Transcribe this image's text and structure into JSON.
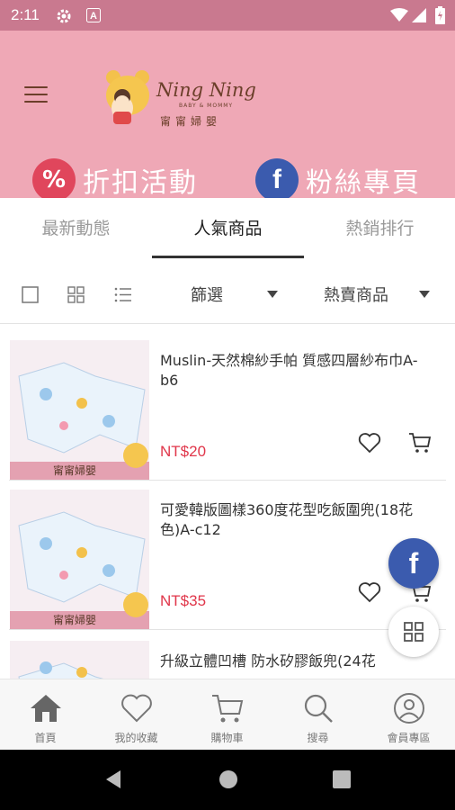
{
  "status_bar": {
    "time": "2:11",
    "icons": [
      "settings-icon",
      "a-notification-icon",
      "wifi-icon",
      "signal-icon",
      "battery-icon"
    ]
  },
  "header": {
    "menu_icon": "hamburger-icon",
    "logo": {
      "brand": "Ning Ning",
      "sub": "BABY & MOMMY",
      "cn": "甯甯婦嬰"
    },
    "promos": [
      {
        "icon": "percent-icon",
        "symbol": "%",
        "label": "折扣活動",
        "color": "#e0465c"
      },
      {
        "icon": "facebook-icon",
        "symbol": "f",
        "label": "粉絲專頁",
        "color": "#3b5bae"
      }
    ]
  },
  "tabs": [
    {
      "label": "最新動態",
      "active": false
    },
    {
      "label": "人氣商品",
      "active": true
    },
    {
      "label": "熱銷排行",
      "active": false
    }
  ],
  "filter_bar": {
    "view_icons": [
      "single-view-icon",
      "grid-view-icon",
      "list-view-icon"
    ],
    "filter_label": "篩選",
    "sort_label": "熱賣商品"
  },
  "products": [
    {
      "name": "Muslin-天然棉紗手帕 質感四層紗布巾A-b6",
      "price": "NT$20",
      "image_text": "甯甯婦嬰"
    },
    {
      "name": "可愛韓版圖樣360度花型吃飯圍兜(18花色)A-c12",
      "price": "NT$35",
      "image_text": "甯甯婦嬰"
    },
    {
      "name": "升級立體凹槽 防水矽膠飯兜(24花",
      "price": "",
      "image_text": ""
    }
  ],
  "floating": {
    "facebook_icon": "facebook-icon",
    "grid_icon": "grid-icon"
  },
  "bottom_nav": [
    {
      "icon": "home-icon",
      "label": "首頁",
      "active": true
    },
    {
      "icon": "heart-icon",
      "label": "我的收藏",
      "active": false
    },
    {
      "icon": "cart-icon",
      "label": "購物車",
      "active": false
    },
    {
      "icon": "search-icon",
      "label": "搜尋",
      "active": false
    },
    {
      "icon": "user-icon",
      "label": "會員專區",
      "active": false
    }
  ],
  "colors": {
    "status_bar": "#c9798f",
    "header": "#efa8b6",
    "price": "#e0364a",
    "facebook": "#3b5bae",
    "discount": "#e0465c"
  }
}
